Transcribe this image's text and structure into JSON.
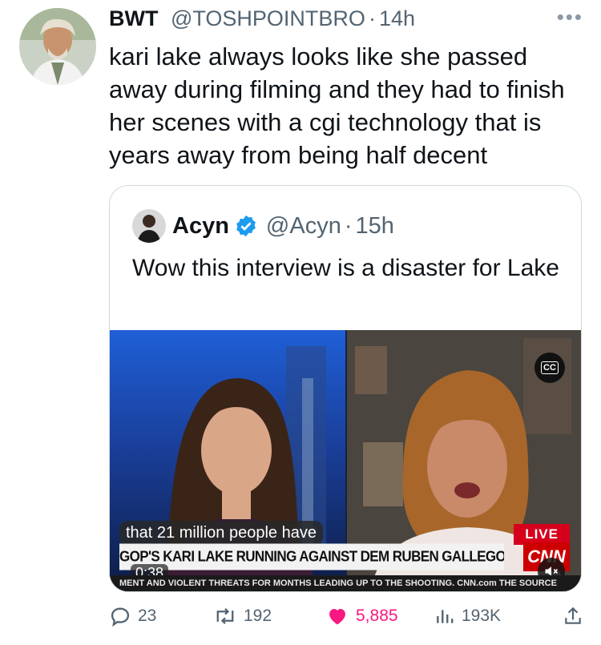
{
  "tweet": {
    "author_name": "BWT",
    "handle": "@TOSHPOINTBRO",
    "separator": "·",
    "time": "14h",
    "text": "kari lake always looks like she passed away during filming and they had to finish her scenes with a cgi technology that is years away from being half decent"
  },
  "quote": {
    "author_name": "Acyn",
    "handle": "@Acyn",
    "separator": "·",
    "time": "15h",
    "text": "Wow this interview is a disaster for Lake",
    "video": {
      "cc_label": "CC",
      "caption": "that 21 million people have",
      "live_label": "LIVE",
      "chyron": "GOP'S KARI LAKE RUNNING AGAINST DEM RUBEN GALLEGO FOR AZ SENATE",
      "network": "CNN",
      "duration": "0:38",
      "ticker": "MENT AND VIOLENT THREATS FOR MONTHS LEADING UP TO THE SHOOTING.   CNN.com   THE SOURCE"
    }
  },
  "metrics": {
    "replies": "23",
    "retweets": "192",
    "likes": "5,885",
    "views": "193K"
  },
  "colors": {
    "like": "#f91880",
    "verified": "#1d9bf0",
    "muted_text": "#536471",
    "live_red": "#d6001c"
  },
  "icons": [
    "more-icon",
    "verified-icon",
    "reply-icon",
    "retweet-icon",
    "heart-icon",
    "views-icon",
    "share-icon",
    "mute-icon",
    "cc-icon"
  ]
}
